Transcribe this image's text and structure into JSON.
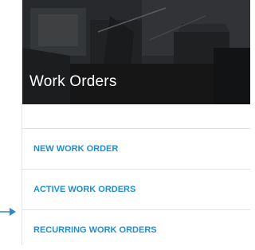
{
  "header": {
    "title": "Work Orders"
  },
  "menu": {
    "items": [
      {
        "label": "NEW WORK ORDER"
      },
      {
        "label": "ACTIVE WORK ORDERS"
      },
      {
        "label": "RECURRING WORK ORDERS"
      }
    ]
  },
  "colors": {
    "link": "#1e8fd1",
    "pointer": "#3b82c4",
    "divider": "#e3e3e3",
    "hero_dark": "#1c1d1e"
  },
  "icons": {
    "pointer": "arrow-right-icon"
  }
}
